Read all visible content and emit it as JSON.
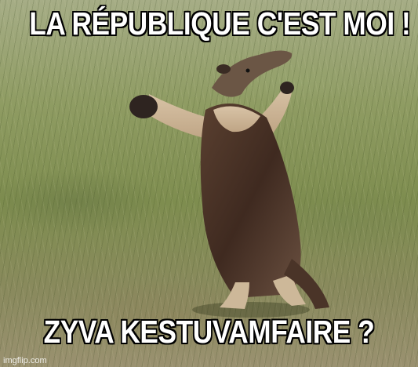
{
  "meme": {
    "top_text": "LA RÉPUBLIQUE C'EST MOI !",
    "bottom_text": "ZYVA KESTUVAMFAIRE ?",
    "watermark": "imgflip.com"
  },
  "photo": {
    "subject": "anteater-standing-icon"
  }
}
